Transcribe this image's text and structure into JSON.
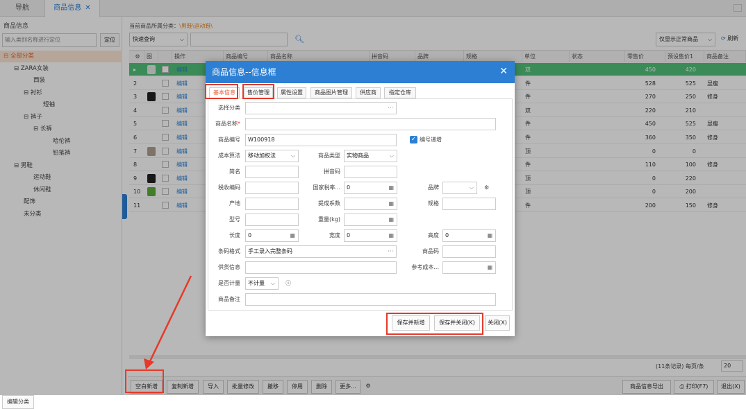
{
  "tabs": {
    "nav": "导航",
    "goods": "商品信息",
    "goods_close": "✕"
  },
  "left": {
    "title": "商品信息",
    "search_placeholder": "输入类别名称进行定位",
    "locate": "定位",
    "tree": [
      {
        "label": "⊟ 全部分类",
        "indent": 5,
        "selected": true
      },
      {
        "label": "⊟ ZARA女装",
        "indent": 20
      },
      {
        "label": "西装",
        "indent": 48
      },
      {
        "label": "⊟ 衬衫",
        "indent": 34
      },
      {
        "label": "短袖",
        "indent": 62
      },
      {
        "label": "⊟ 裤子",
        "indent": 34
      },
      {
        "label": "⊟ 长裤",
        "indent": 48
      },
      {
        "label": "哈伦裤",
        "indent": 76
      },
      {
        "label": "铅笔裤",
        "indent": 76
      },
      {
        "label": "⊟ 男鞋",
        "indent": 20
      },
      {
        "label": "运动鞋",
        "indent": 48
      },
      {
        "label": "休闲鞋",
        "indent": 48
      },
      {
        "label": "配饰",
        "indent": 34
      },
      {
        "label": "未分类",
        "indent": 34
      }
    ],
    "edit_category": "编辑分类"
  },
  "main": {
    "crumb_label": "当前商品所属分类：",
    "crumb_value": "\\男鞋\\运动鞋\\",
    "query_select": "快速查询",
    "normal_select": "仅显示正常商品",
    "refresh": "刷新",
    "columns": [
      "图",
      "操作",
      "商品编号",
      "商品名称",
      "拼音码",
      "品牌",
      "规格",
      "单位",
      "状态",
      "零售价",
      "预设售价1",
      "商品备注"
    ],
    "rows": [
      {
        "n": "▸",
        "op": "编辑",
        "unit": "双",
        "retail": "450",
        "price1": "420",
        "note": ""
      },
      {
        "n": "2",
        "op": "编辑",
        "unit": "件",
        "retail": "528",
        "price1": "525",
        "note": "显瘦"
      },
      {
        "n": "3",
        "op": "编辑",
        "unit": "件",
        "retail": "270",
        "price1": "250",
        "note": "修身"
      },
      {
        "n": "4",
        "op": "编辑",
        "unit": "双",
        "retail": "220",
        "price1": "210",
        "note": ""
      },
      {
        "n": "5",
        "op": "编辑",
        "unit": "件",
        "retail": "450",
        "price1": "525",
        "note": "显瘦"
      },
      {
        "n": "6",
        "op": "编辑",
        "unit": "件",
        "retail": "360",
        "price1": "350",
        "note": "修身"
      },
      {
        "n": "7",
        "op": "编辑",
        "unit": "顶",
        "retail": "0",
        "price1": "0",
        "note": ""
      },
      {
        "n": "8",
        "op": "编辑",
        "unit": "件",
        "retail": "110",
        "price1": "100",
        "note": "修身"
      },
      {
        "n": "9",
        "op": "编辑",
        "unit": "顶",
        "retail": "0",
        "price1": "220",
        "note": ""
      },
      {
        "n": "10",
        "op": "编辑",
        "unit": "顶",
        "retail": "0",
        "price1": "200",
        "note": ""
      },
      {
        "n": "11",
        "op": "编辑",
        "unit": "件",
        "retail": "200",
        "price1": "150",
        "note": "修身"
      }
    ],
    "pager_text": "(11条记录)  每页/条",
    "page_size": "20",
    "buttons": [
      "空白新增",
      "复制新增",
      "导入",
      "批量修改",
      "搬移",
      "停用",
      "删除",
      "更多..."
    ],
    "export": "商品信息导出",
    "print": "打印(F7)",
    "exit": "退出(X)"
  },
  "dialog": {
    "title": "商品信息--信息框",
    "tabs": [
      "基本信息",
      "售价管理",
      "属性设置",
      "商品图片管理",
      "供应商",
      "指定仓库"
    ],
    "labels": {
      "category": "选择分类",
      "name": "商品名称",
      "name_req": "*",
      "code": "商品编号",
      "auto_code": "编号递增",
      "cost_method": "成本算法",
      "goods_type": "商品类型",
      "short_name": "简名",
      "pinyin": "拼音码",
      "tax_code": "税收编码",
      "tax_rate": "国家税率...",
      "brand": "品牌",
      "origin": "产地",
      "discount": "提成系数",
      "spec": "规格",
      "model": "型号",
      "weight": "重量(kg)",
      "length": "长度",
      "width": "宽度",
      "height": "高度",
      "barcode_fmt": "条码格式",
      "barcode": "商品码",
      "supplier": "供货信息",
      "ref_cost": "参考成本...",
      "metered": "是否计量",
      "remark": "商品备注"
    },
    "values": {
      "code": "W100918",
      "cost_method": "移动加权法",
      "goods_type": "实物商品",
      "tax_rate": "0",
      "length": "0",
      "width": "0",
      "height": "0",
      "barcode_fmt": "手工录入完整条码",
      "metered": "不计量"
    },
    "footer": {
      "save_new": "保存并新增",
      "save_close": "保存并关闭(K)",
      "close": "关闭(X)"
    }
  }
}
